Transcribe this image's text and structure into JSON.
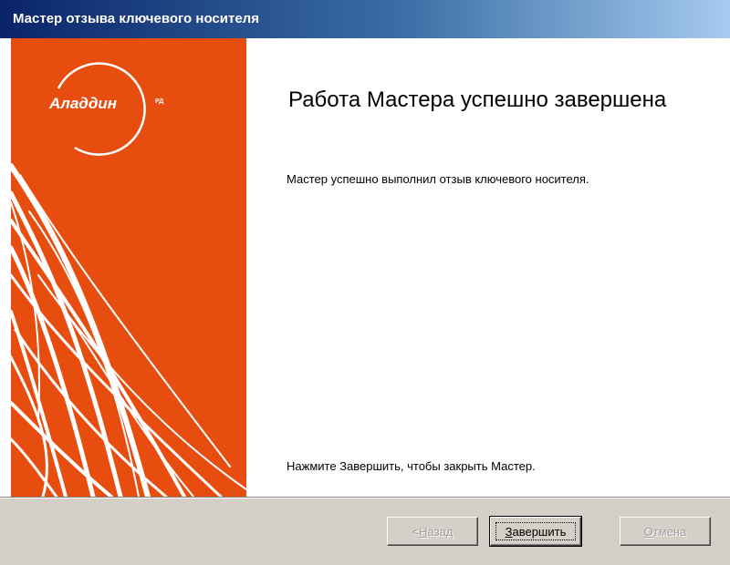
{
  "window": {
    "title": "Мастер отзыва ключевого носителя"
  },
  "banner": {
    "logo_text": "Аладдин",
    "logo_superscript": "РД",
    "color": "#e74d0f"
  },
  "content": {
    "heading": "Работа Мастера успешно завершена",
    "description": "Мастер успешно выполнил отзыв ключевого носителя.",
    "hint": "Нажмите Завершить, чтобы закрыть Мастер."
  },
  "buttons": {
    "back": {
      "prefix": "< ",
      "mnemonic": "Н",
      "rest": "азад",
      "enabled": false
    },
    "finish": {
      "prefix": "",
      "mnemonic": "З",
      "rest": "авершить",
      "enabled": true
    },
    "cancel": {
      "prefix": "",
      "mnemonic": "О",
      "rest": "тмена",
      "enabled": false
    }
  }
}
